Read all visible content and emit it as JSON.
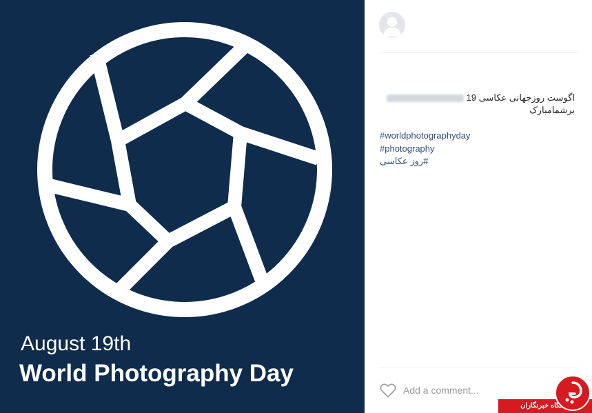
{
  "post_image": {
    "line1": "August 19th",
    "line2": "World Photography Day",
    "background_color": "#0f2c4c",
    "icon": "camera-aperture-icon"
  },
  "author": {
    "avatar_icon": "default-user-avatar"
  },
  "caption": {
    "text": "اگوست روزجهانی عکاسی 19",
    "line2": "برشمامبارک"
  },
  "hashtags": [
    "#worldphotographyday",
    "#photography",
    "#روز عکاسی"
  ],
  "actions": {
    "like_icon": "heart-outline-icon",
    "comment_placeholder": "Add a comment..."
  },
  "watermark": {
    "text": "باشگاه خبرنگاران",
    "accent_color": "#d71920"
  }
}
